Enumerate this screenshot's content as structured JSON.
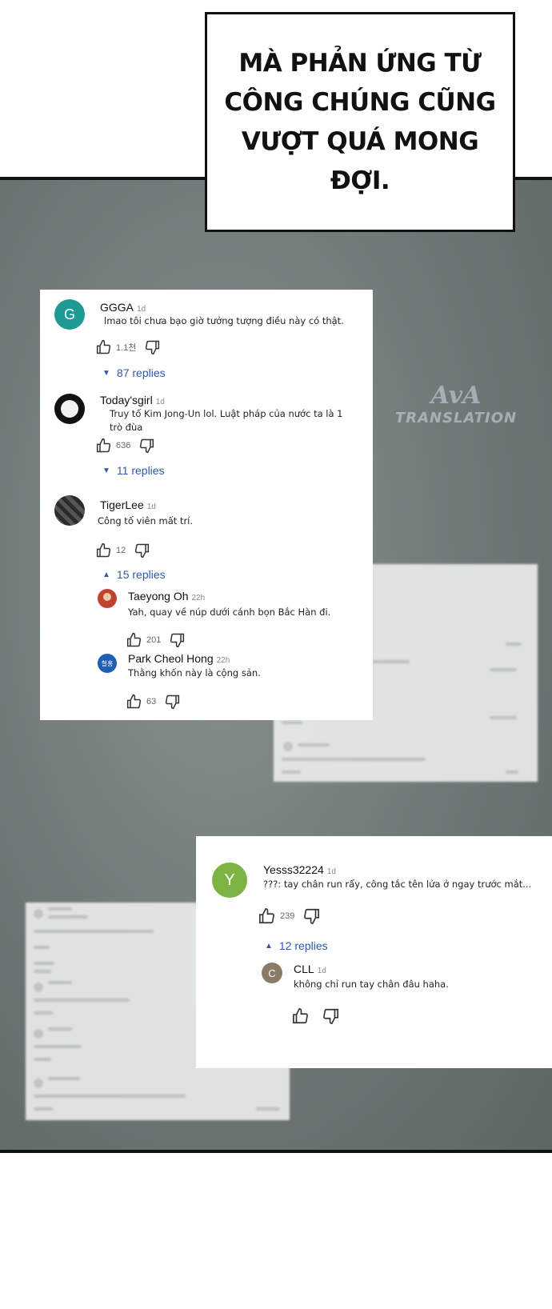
{
  "narration": {
    "text": "MÀ PHẢN ỨNG TỪ CÔNG CHÚNG CŨNG VƯỢT QUÁ MONG ĐỢI."
  },
  "watermark": {
    "logo": "AvA",
    "text": "TRANSLATION"
  },
  "card1": {
    "comments": [
      {
        "avatar_letter": "G",
        "avatar_color": "#1e9a95",
        "name": "GGGA",
        "time": "1d",
        "text": "lmao tôi chưa bạo giờ tưởng tượng điều này có thật.",
        "likes": "1.1천",
        "replies": "87 replies",
        "replies_caret": "▼"
      },
      {
        "avatar_letter": "",
        "avatar_color": "#111111",
        "name": "Today'sgirl",
        "time": "1d",
        "text": "Truy tố Kim Jong-Un lol. Luật pháp của nước ta là 1 trò đùa",
        "likes": "636",
        "replies": "11 replies",
        "replies_caret": "▼"
      },
      {
        "avatar_letter": "",
        "avatar_color": "#3a3a3a",
        "name": "TigerLee",
        "time": "1d",
        "text": "Công tố viên mất trí.",
        "likes": "12",
        "replies": "15 replies",
        "replies_caret": "▲"
      }
    ],
    "sub_replies": [
      {
        "avatar_letter": "",
        "avatar_color": "#c0432f",
        "name": "Taeyong Oh",
        "time": "22h",
        "text": "Yah, quay về núp dưới cánh bọn Bắc Hàn đi.",
        "likes": "201"
      },
      {
        "avatar_letter": "철홍",
        "avatar_color": "#1d5fb0",
        "name": "Park Cheol Hong",
        "time": "22h",
        "text": "Thằng khốn này là cộng sản.",
        "likes": "63"
      }
    ]
  },
  "card2": {
    "comment": {
      "avatar_letter": "Y",
      "avatar_color": "#7cb342",
      "name": "Yesss32224",
      "time": "1d",
      "text": "???: tay chân run rẩy, công tắc tên lửa ở ngay trước mắt...",
      "likes": "239",
      "replies": "12 replies",
      "replies_caret": "▲"
    },
    "sub_reply": {
      "avatar_letter": "C",
      "avatar_color": "#8d7b6a",
      "name": "CLL",
      "time": "1d",
      "text": "không chỉ run tay chân đâu haha.",
      "likes": ""
    }
  },
  "icons": {
    "like": "thumbs-up-icon",
    "dislike": "thumbs-down-icon"
  }
}
